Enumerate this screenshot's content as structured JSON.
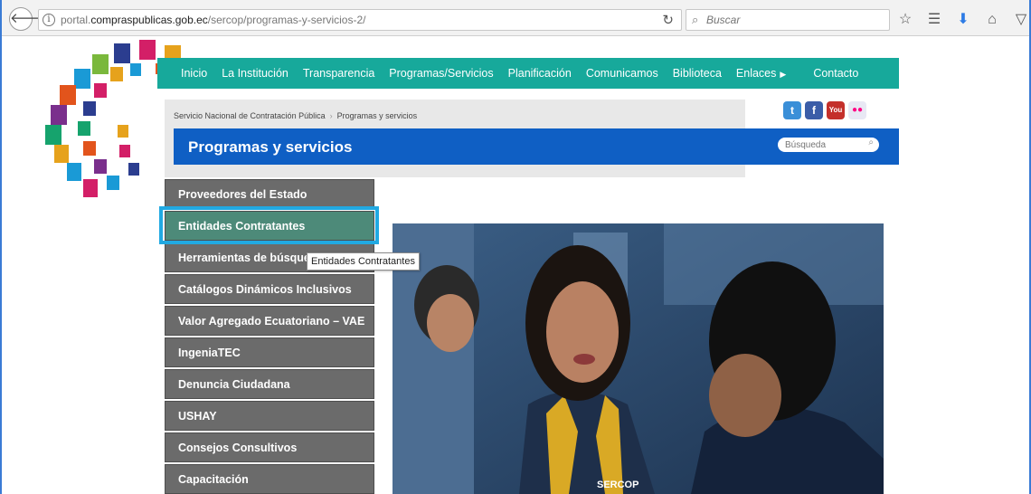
{
  "browser": {
    "url_prefix": "portal.",
    "url_domain": "compraspublicas.gob.ec",
    "url_path": "/sercop/programas-y-servicios-2/",
    "search_placeholder": "Buscar"
  },
  "topnav": {
    "items": [
      "Inicio",
      "La Institución",
      "Transparencia",
      "Programas/Servicios",
      "Planificación",
      "Comunicamos",
      "Biblioteca",
      "Enlaces",
      "Contacto"
    ]
  },
  "breadcrumb": {
    "root": "Servicio Nacional de Contratación Pública",
    "separator": "›",
    "current": "Programas y servicios"
  },
  "social": {
    "twitter": "t",
    "facebook": "f",
    "youtube": "You Tube",
    "flickr": "●●"
  },
  "title": "Programas y servicios",
  "page_search_placeholder": "Búsqueda",
  "sidebar": {
    "items": [
      "Proveedores del Estado",
      "Entidades Contratantes",
      "Herramientas de búsqueda",
      "Catálogos Dinámicos Inclusivos",
      "Valor Agregado Ecuatoriano – VAE",
      "IngeniaTEC",
      "Denuncia Ciudadana",
      "USHAY",
      "Consejos Consultivos",
      "Capacitación"
    ]
  },
  "tooltip": "Entidades Contratantes",
  "hero": {
    "badge": "SERCOP"
  },
  "colors": {
    "nav": "#17a99b",
    "title_bar": "#0f5fc4",
    "menu": "#6b6b6b",
    "menu_active": "#4d8a79",
    "highlight": "#21a9e2"
  }
}
